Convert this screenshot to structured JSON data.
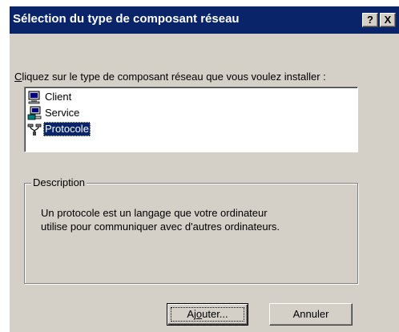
{
  "window": {
    "title": "Sélection du type de composant réseau",
    "help_button": "?",
    "close_button": "X"
  },
  "instruction": {
    "mnemonic": "C",
    "rest": "liquez sur le type de composant réseau que vous voulez installer :"
  },
  "list": {
    "items": [
      {
        "label": "Client",
        "icon": "client-computer-icon",
        "selected": false
      },
      {
        "label": "Service",
        "icon": "service-computer-icon",
        "selected": false
      },
      {
        "label": "Protocole",
        "icon": "protocol-plug-icon",
        "selected": true
      }
    ]
  },
  "description": {
    "legend": "Description",
    "line1": "Un protocole est un langage que votre ordinateur",
    "line2": "utilise pour communiquer avec d'autres ordinateurs."
  },
  "buttons": {
    "add": {
      "prefix": "Aj",
      "mnemonic": "o",
      "suffix": "uter..."
    },
    "cancel": "Annuler"
  },
  "colors": {
    "titlebar": "#0a246a",
    "face": "#d4d0c8",
    "selection": "#0a246a"
  }
}
